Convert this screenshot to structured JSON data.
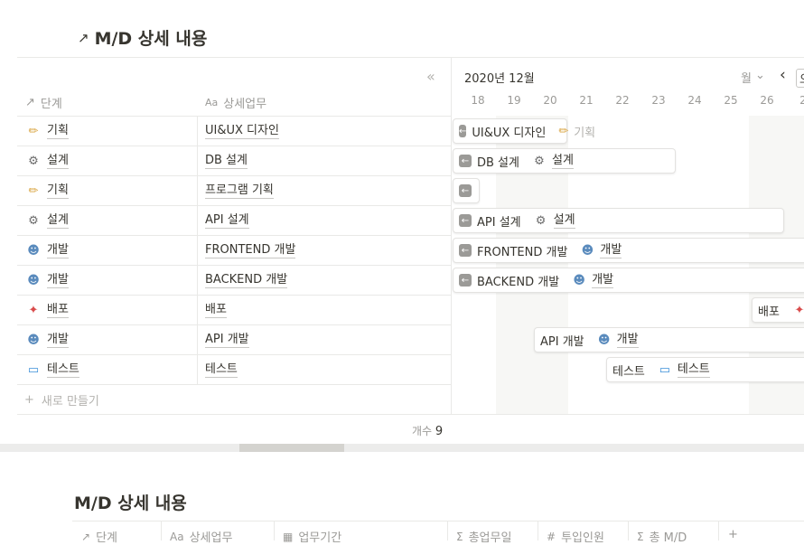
{
  "view1": {
    "title": "M/D 상세 내용",
    "collapse_icon": "«",
    "columns": {
      "stage": "단계",
      "task": "상세업무"
    },
    "rows": [
      {
        "stage": "기획",
        "stage_icon": "pencil-icon",
        "task": "UI&UX 디자인"
      },
      {
        "stage": "설계",
        "stage_icon": "gear-icon",
        "task": "DB 설계"
      },
      {
        "stage": "기획",
        "stage_icon": "pencil-icon",
        "task": "프로그램 기획"
      },
      {
        "stage": "설계",
        "stage_icon": "gear-icon",
        "task": "API 설계"
      },
      {
        "stage": "개발",
        "stage_icon": "technologist-icon",
        "task": "FRONTEND 개발"
      },
      {
        "stage": "개발",
        "stage_icon": "technologist-icon",
        "task": "BACKEND 개발"
      },
      {
        "stage": "배포",
        "stage_icon": "party-popper-icon",
        "task": "배포"
      },
      {
        "stage": "개발",
        "stage_icon": "technologist-icon",
        "task": "API 개발"
      },
      {
        "stage": "테스트",
        "stage_icon": "monitor-icon",
        "task": "테스트"
      }
    ],
    "new_row": "새로 만들기",
    "count_label": "개수",
    "count_value": "9",
    "timeline": {
      "month": "2020년 12월",
      "scale": "월",
      "scale_chevron": "⌄",
      "prev": "‹",
      "next_partial": "오",
      "days": [
        "18",
        "19",
        "20",
        "21",
        "22",
        "23",
        "24",
        "25",
        "26",
        "2"
      ],
      "bars": [
        {
          "task": "UI&UX 디자인",
          "stage": "기획",
          "stage_icon": "pencil-icon"
        },
        {
          "task": "DB 설계",
          "stage": "설계",
          "stage_icon": "gear-icon"
        },
        {
          "task": "",
          "stage": "",
          "stage_icon": ""
        },
        {
          "task": "API 설계",
          "stage": "설계",
          "stage_icon": "gear-icon"
        },
        {
          "task": "FRONTEND 개발",
          "stage": "개발",
          "stage_icon": "technologist-icon"
        },
        {
          "task": "BACKEND 개발",
          "stage": "개발",
          "stage_icon": "technologist-icon"
        },
        {
          "task": "배포",
          "stage": "",
          "stage_icon": "party-popper-icon"
        },
        {
          "task": "API 개발",
          "stage": "개발",
          "stage_icon": "technologist-icon"
        },
        {
          "task": "테스트",
          "stage": "테스트",
          "stage_icon": "monitor-icon"
        }
      ]
    }
  },
  "view2": {
    "title": "M/D 상세 내용",
    "columns": [
      "단계",
      "상세업무",
      "업무기간",
      "총업무일",
      "투입인원",
      "총 M/D"
    ],
    "add_column": "+"
  }
}
